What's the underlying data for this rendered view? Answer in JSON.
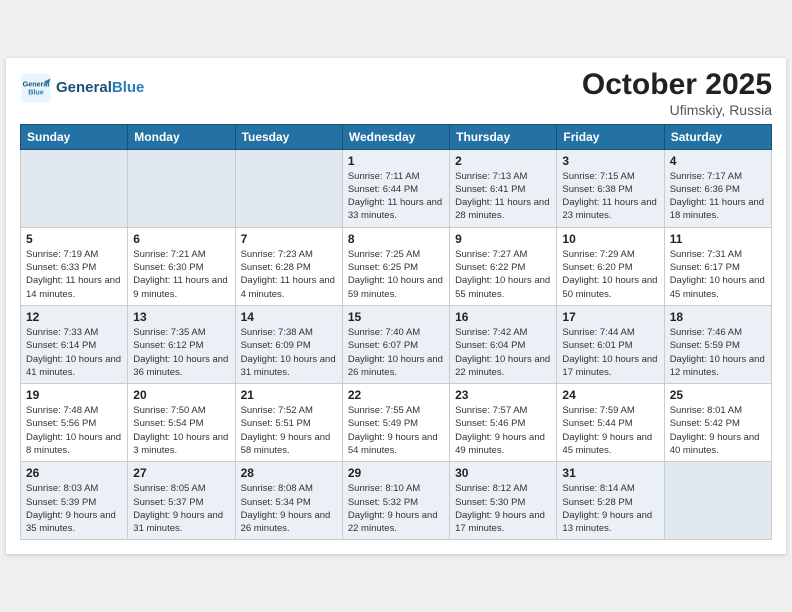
{
  "header": {
    "logo_line1": "General",
    "logo_line2": "Blue",
    "month": "October 2025",
    "location": "Ufimskiy, Russia"
  },
  "weekdays": [
    "Sunday",
    "Monday",
    "Tuesday",
    "Wednesday",
    "Thursday",
    "Friday",
    "Saturday"
  ],
  "weeks": [
    [
      {
        "day": "",
        "sunrise": "",
        "sunset": "",
        "daylight": "",
        "empty": true
      },
      {
        "day": "",
        "sunrise": "",
        "sunset": "",
        "daylight": "",
        "empty": true
      },
      {
        "day": "",
        "sunrise": "",
        "sunset": "",
        "daylight": "",
        "empty": true
      },
      {
        "day": "1",
        "sunrise": "Sunrise: 7:11 AM",
        "sunset": "Sunset: 6:44 PM",
        "daylight": "Daylight: 11 hours and 33 minutes.",
        "empty": false
      },
      {
        "day": "2",
        "sunrise": "Sunrise: 7:13 AM",
        "sunset": "Sunset: 6:41 PM",
        "daylight": "Daylight: 11 hours and 28 minutes.",
        "empty": false
      },
      {
        "day": "3",
        "sunrise": "Sunrise: 7:15 AM",
        "sunset": "Sunset: 6:38 PM",
        "daylight": "Daylight: 11 hours and 23 minutes.",
        "empty": false
      },
      {
        "day": "4",
        "sunrise": "Sunrise: 7:17 AM",
        "sunset": "Sunset: 6:36 PM",
        "daylight": "Daylight: 11 hours and 18 minutes.",
        "empty": false
      }
    ],
    [
      {
        "day": "5",
        "sunrise": "Sunrise: 7:19 AM",
        "sunset": "Sunset: 6:33 PM",
        "daylight": "Daylight: 11 hours and 14 minutes.",
        "empty": false
      },
      {
        "day": "6",
        "sunrise": "Sunrise: 7:21 AM",
        "sunset": "Sunset: 6:30 PM",
        "daylight": "Daylight: 11 hours and 9 minutes.",
        "empty": false
      },
      {
        "day": "7",
        "sunrise": "Sunrise: 7:23 AM",
        "sunset": "Sunset: 6:28 PM",
        "daylight": "Daylight: 11 hours and 4 minutes.",
        "empty": false
      },
      {
        "day": "8",
        "sunrise": "Sunrise: 7:25 AM",
        "sunset": "Sunset: 6:25 PM",
        "daylight": "Daylight: 10 hours and 59 minutes.",
        "empty": false
      },
      {
        "day": "9",
        "sunrise": "Sunrise: 7:27 AM",
        "sunset": "Sunset: 6:22 PM",
        "daylight": "Daylight: 10 hours and 55 minutes.",
        "empty": false
      },
      {
        "day": "10",
        "sunrise": "Sunrise: 7:29 AM",
        "sunset": "Sunset: 6:20 PM",
        "daylight": "Daylight: 10 hours and 50 minutes.",
        "empty": false
      },
      {
        "day": "11",
        "sunrise": "Sunrise: 7:31 AM",
        "sunset": "Sunset: 6:17 PM",
        "daylight": "Daylight: 10 hours and 45 minutes.",
        "empty": false
      }
    ],
    [
      {
        "day": "12",
        "sunrise": "Sunrise: 7:33 AM",
        "sunset": "Sunset: 6:14 PM",
        "daylight": "Daylight: 10 hours and 41 minutes.",
        "empty": false
      },
      {
        "day": "13",
        "sunrise": "Sunrise: 7:35 AM",
        "sunset": "Sunset: 6:12 PM",
        "daylight": "Daylight: 10 hours and 36 minutes.",
        "empty": false
      },
      {
        "day": "14",
        "sunrise": "Sunrise: 7:38 AM",
        "sunset": "Sunset: 6:09 PM",
        "daylight": "Daylight: 10 hours and 31 minutes.",
        "empty": false
      },
      {
        "day": "15",
        "sunrise": "Sunrise: 7:40 AM",
        "sunset": "Sunset: 6:07 PM",
        "daylight": "Daylight: 10 hours and 26 minutes.",
        "empty": false
      },
      {
        "day": "16",
        "sunrise": "Sunrise: 7:42 AM",
        "sunset": "Sunset: 6:04 PM",
        "daylight": "Daylight: 10 hours and 22 minutes.",
        "empty": false
      },
      {
        "day": "17",
        "sunrise": "Sunrise: 7:44 AM",
        "sunset": "Sunset: 6:01 PM",
        "daylight": "Daylight: 10 hours and 17 minutes.",
        "empty": false
      },
      {
        "day": "18",
        "sunrise": "Sunrise: 7:46 AM",
        "sunset": "Sunset: 5:59 PM",
        "daylight": "Daylight: 10 hours and 12 minutes.",
        "empty": false
      }
    ],
    [
      {
        "day": "19",
        "sunrise": "Sunrise: 7:48 AM",
        "sunset": "Sunset: 5:56 PM",
        "daylight": "Daylight: 10 hours and 8 minutes.",
        "empty": false
      },
      {
        "day": "20",
        "sunrise": "Sunrise: 7:50 AM",
        "sunset": "Sunset: 5:54 PM",
        "daylight": "Daylight: 10 hours and 3 minutes.",
        "empty": false
      },
      {
        "day": "21",
        "sunrise": "Sunrise: 7:52 AM",
        "sunset": "Sunset: 5:51 PM",
        "daylight": "Daylight: 9 hours and 58 minutes.",
        "empty": false
      },
      {
        "day": "22",
        "sunrise": "Sunrise: 7:55 AM",
        "sunset": "Sunset: 5:49 PM",
        "daylight": "Daylight: 9 hours and 54 minutes.",
        "empty": false
      },
      {
        "day": "23",
        "sunrise": "Sunrise: 7:57 AM",
        "sunset": "Sunset: 5:46 PM",
        "daylight": "Daylight: 9 hours and 49 minutes.",
        "empty": false
      },
      {
        "day": "24",
        "sunrise": "Sunrise: 7:59 AM",
        "sunset": "Sunset: 5:44 PM",
        "daylight": "Daylight: 9 hours and 45 minutes.",
        "empty": false
      },
      {
        "day": "25",
        "sunrise": "Sunrise: 8:01 AM",
        "sunset": "Sunset: 5:42 PM",
        "daylight": "Daylight: 9 hours and 40 minutes.",
        "empty": false
      }
    ],
    [
      {
        "day": "26",
        "sunrise": "Sunrise: 8:03 AM",
        "sunset": "Sunset: 5:39 PM",
        "daylight": "Daylight: 9 hours and 35 minutes.",
        "empty": false
      },
      {
        "day": "27",
        "sunrise": "Sunrise: 8:05 AM",
        "sunset": "Sunset: 5:37 PM",
        "daylight": "Daylight: 9 hours and 31 minutes.",
        "empty": false
      },
      {
        "day": "28",
        "sunrise": "Sunrise: 8:08 AM",
        "sunset": "Sunset: 5:34 PM",
        "daylight": "Daylight: 9 hours and 26 minutes.",
        "empty": false
      },
      {
        "day": "29",
        "sunrise": "Sunrise: 8:10 AM",
        "sunset": "Sunset: 5:32 PM",
        "daylight": "Daylight: 9 hours and 22 minutes.",
        "empty": false
      },
      {
        "day": "30",
        "sunrise": "Sunrise: 8:12 AM",
        "sunset": "Sunset: 5:30 PM",
        "daylight": "Daylight: 9 hours and 17 minutes.",
        "empty": false
      },
      {
        "day": "31",
        "sunrise": "Sunrise: 8:14 AM",
        "sunset": "Sunset: 5:28 PM",
        "daylight": "Daylight: 9 hours and 13 minutes.",
        "empty": false
      },
      {
        "day": "",
        "sunrise": "",
        "sunset": "",
        "daylight": "",
        "empty": true
      }
    ]
  ]
}
